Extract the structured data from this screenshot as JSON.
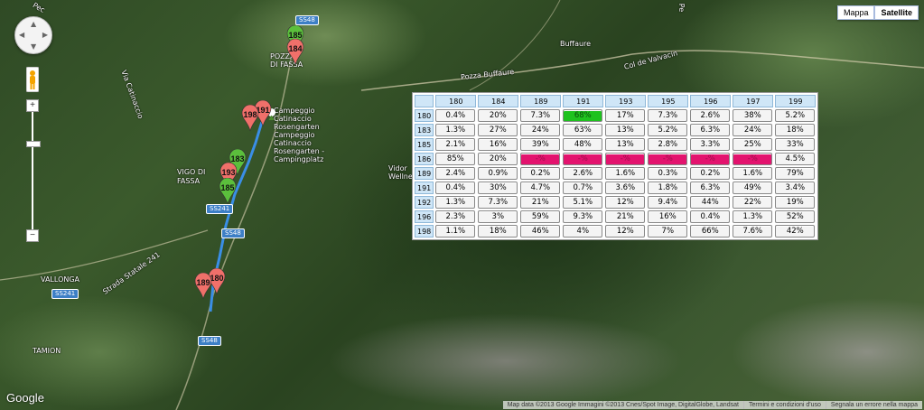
{
  "map_type": {
    "options": [
      "Mappa",
      "Satellite"
    ],
    "active": "Satellite"
  },
  "place_labels": {
    "pozza": "POZZA\nDI FASSA",
    "vigo": "VIGO DI\nFASSA",
    "vallonga": "VALLONGA",
    "tamion": "TAMION",
    "buffaure": "Buffaure",
    "pozza_buffaure": "Pozza Buffaure",
    "col_de_valvacin": "Col de Valvacin",
    "strada_catinaccio": "Via Catinaccio",
    "strada_statale": "Strada Statale 241",
    "campeggio": "Campeggio\nCatinaccio\nRosengarten\nCampeggio\nCatinaccio\nRosengarten -\nCampingplatz",
    "vidor": "Vidor\nWellne",
    "pec": "Pec",
    "pe": "Pe"
  },
  "road_shields": {
    "ss48_top": "SS48",
    "ss241_mid": "SS241",
    "ss48_mid": "SS48",
    "ss241_left": "SS241",
    "ss48_bottom": "SS48"
  },
  "markers": [
    {
      "label": "185",
      "color": "#5bbf3c"
    },
    {
      "label": "184",
      "color": "#f0706a"
    },
    {
      "label": "198",
      "color": "#f0706a"
    },
    {
      "label": "191",
      "color": "#f0706a"
    },
    {
      "label": "183",
      "color": "#5bbf3c"
    },
    {
      "label": "193",
      "color": "#f0706a"
    },
    {
      "label": "185",
      "color": "#5bbf3c"
    },
    {
      "label": "189",
      "color": "#f0706a"
    },
    {
      "label": "180",
      "color": "#f0706a"
    }
  ],
  "logo": "Google",
  "attribution": {
    "data": "Map data ©2013 Google Immagini ©2013 Cnes/Spot Image, DigitalGlobe, Landsat",
    "terms": "Termini e condizioni d'uso",
    "report": "Segnala un errore nella mappa"
  },
  "matrix": {
    "columns": [
      "180",
      "184",
      "189",
      "191",
      "193",
      "195",
      "196",
      "197",
      "199"
    ],
    "rows": [
      {
        "id": "180",
        "cells": [
          "0.4%",
          "20%",
          "7.3%",
          "68%",
          "17%",
          "7.3%",
          "2.6%",
          "38%",
          "5.2%"
        ],
        "best": 3
      },
      {
        "id": "183",
        "cells": [
          "1.3%",
          "27%",
          "24%",
          "63%",
          "13%",
          "5.2%",
          "6.3%",
          "24%",
          "18%"
        ]
      },
      {
        "id": "185",
        "cells": [
          "2.1%",
          "16%",
          "39%",
          "48%",
          "13%",
          "2.8%",
          "3.3%",
          "25%",
          "33%"
        ]
      },
      {
        "id": "186",
        "cells": [
          "85%",
          "20%",
          "-%",
          "-%",
          "-%",
          "-%",
          "-%",
          "-%",
          "4.5%"
        ],
        "na": [
          2,
          3,
          4,
          5,
          6,
          7
        ]
      },
      {
        "id": "189",
        "cells": [
          "2.4%",
          "0.9%",
          "0.2%",
          "2.6%",
          "1.6%",
          "0.3%",
          "0.2%",
          "1.6%",
          "79%"
        ]
      },
      {
        "id": "191",
        "cells": [
          "0.4%",
          "30%",
          "4.7%",
          "0.7%",
          "3.6%",
          "1.8%",
          "6.3%",
          "49%",
          "3.4%"
        ]
      },
      {
        "id": "192",
        "cells": [
          "1.3%",
          "7.3%",
          "21%",
          "5.1%",
          "12%",
          "9.4%",
          "44%",
          "22%",
          "19%"
        ]
      },
      {
        "id": "196",
        "cells": [
          "2.3%",
          "3%",
          "59%",
          "9.3%",
          "21%",
          "16%",
          "0.4%",
          "1.3%",
          "52%"
        ]
      },
      {
        "id": "198",
        "cells": [
          "1.1%",
          "18%",
          "46%",
          "4%",
          "12%",
          "7%",
          "66%",
          "7.6%",
          "42%"
        ]
      }
    ]
  }
}
